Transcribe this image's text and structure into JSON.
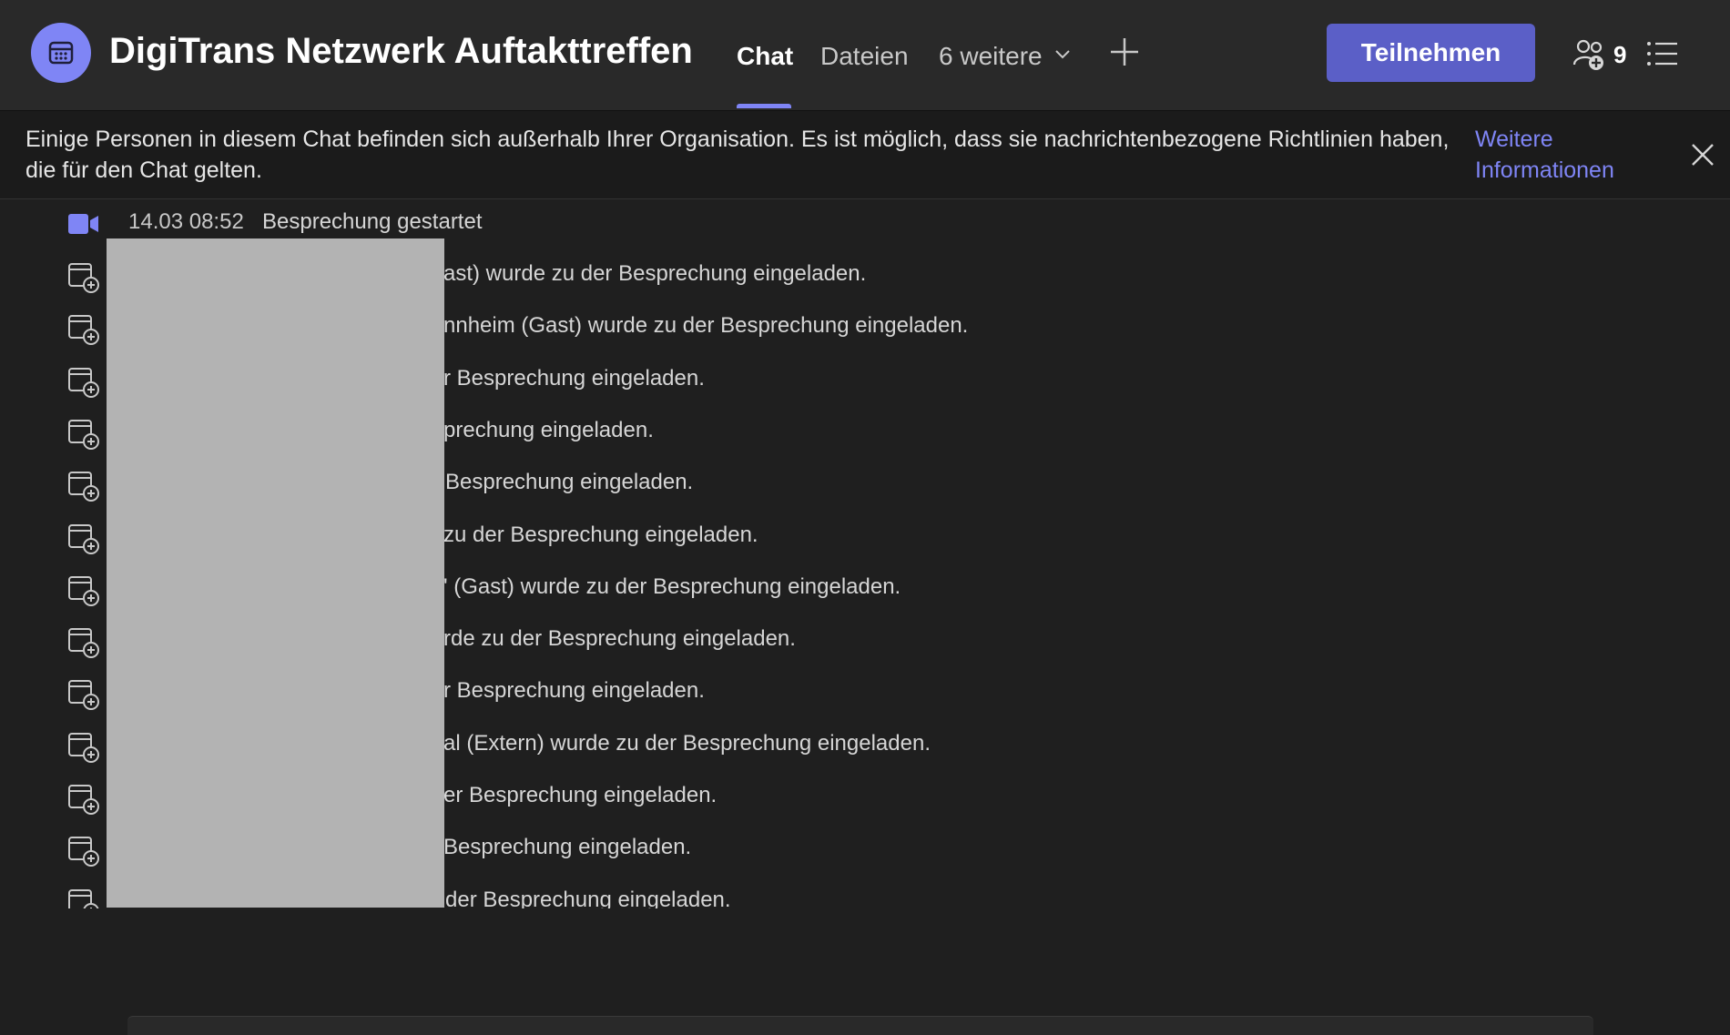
{
  "header": {
    "title": "DigiTrans Netzwerk Auftakttreffen",
    "tabs": [
      {
        "label": "Chat",
        "active": true
      },
      {
        "label": "Dateien",
        "active": false
      },
      {
        "label": "6 weitere",
        "active": false
      }
    ],
    "join_label": "Teilnehmen",
    "participant_count": "9",
    "accent_color": "#7f85f5",
    "button_color": "#5b5fc7"
  },
  "banner": {
    "text": "Einige Personen in diesem Chat befinden sich außerhalb Ihrer Organisation. Es ist möglich, dass sie nachrichtenbezogene Richtlinien haben, die für den Chat gelten.",
    "link": "Weitere Informationen"
  },
  "events": {
    "started": {
      "time": "14.03 08:52",
      "text": "Besprechung gestartet"
    },
    "invites": [
      "ast) wurde zu der Besprechung eingeladen.",
      "nnheim (Gast) wurde zu der Besprechung eingeladen.",
      "r Besprechung eingeladen.",
      "prechung eingeladen.",
      "Besprechung eingeladen.",
      "zu der Besprechung eingeladen.",
      "' (Gast) wurde zu der Besprechung eingeladen.",
      "rde zu der Besprechung eingeladen.",
      "r Besprechung eingeladen.",
      "al (Extern) wurde zu der Besprechung eingeladen.",
      "er Besprechung eingeladen.",
      " Besprechung eingeladen.",
      "der Besprechung eingeladen."
    ]
  }
}
